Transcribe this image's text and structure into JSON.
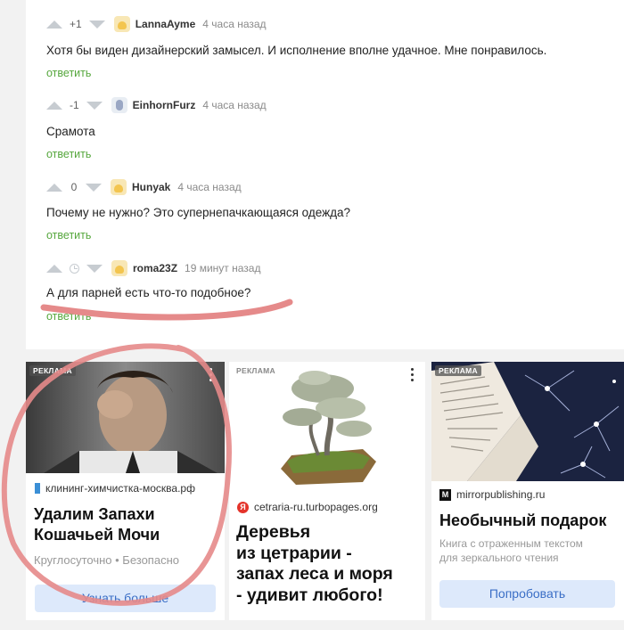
{
  "comments": [
    {
      "rating": "+1",
      "author": "LannaAyme",
      "time": "4 часа назад",
      "text": "Хотя бы виден дизайнерский замысел. И исполнение вполне удачное. Мне понравилось.",
      "reply": "ответить",
      "avatar": "smiling-face-avatar"
    },
    {
      "rating": "-1",
      "author": "EinhornFurz",
      "time": "4 часа назад",
      "text": "Срамота",
      "reply": "ответить",
      "avatar": "character-avatar"
    },
    {
      "rating": "0",
      "author": "Hunyak",
      "time": "4 часа назад",
      "text": "Почему не нужно? Это супернепачкающаяся одежда?",
      "reply": "ответить",
      "avatar": "smiling-face-avatar"
    },
    {
      "rating": "",
      "author": "roma23Z",
      "time": "19 минут назад",
      "text": "А для парней есть что-то подобное?",
      "reply": "ответить",
      "avatar": "smiling-face-avatar"
    }
  ],
  "ads": [
    {
      "badge": "РЕКЛАМА",
      "domain": "клининг-химчистка-москва.рф",
      "title_line1": "Удалим Запахи",
      "title_line2": "Кошачьей Мочи",
      "desc": "Круглосуточно • Безопасно",
      "button": "Узнать больше",
      "image": "man-holding-nose-photo"
    },
    {
      "badge": "РЕКЛАМА",
      "domain": "cetraria-ru.turbopages.org",
      "title_line1": "Деревья",
      "title_line2": "из цетрарии -",
      "title_line3": "запах леса и моря",
      "title_line4": "- удивит любого!",
      "image": "bonsai-tree-photo"
    },
    {
      "badge": "РЕКЛАМА",
      "domain": "mirrorpublishing.ru",
      "title_line1": "Необычный подарок",
      "desc_line1": "Книга с отраженным текстом",
      "desc_line2": "для зеркального чтения",
      "button": "Попробовать",
      "image": "open-book-photo"
    }
  ],
  "colors": {
    "reply": "#56a73d",
    "annotation": "#e58a8a",
    "button_bg": "#dde9fb",
    "button_text": "#3a6ec6"
  }
}
